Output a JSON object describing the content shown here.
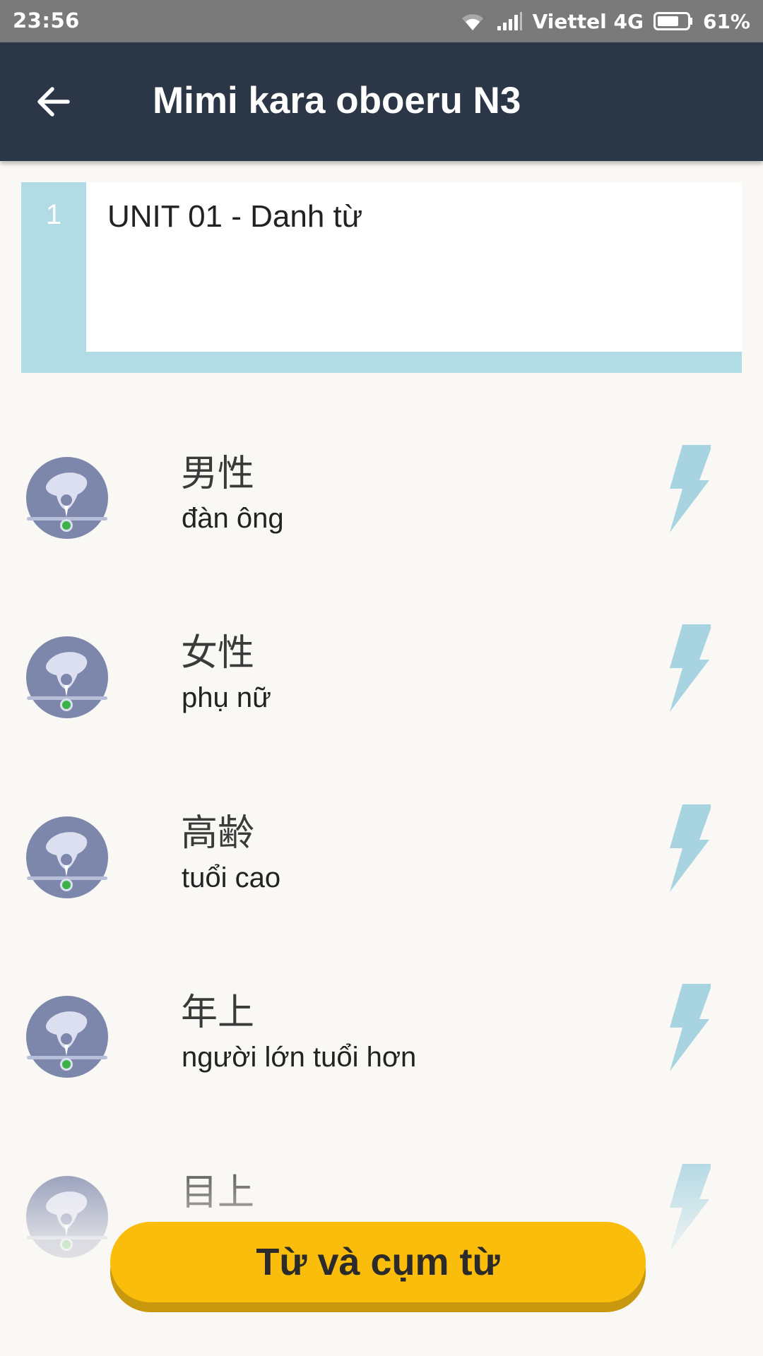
{
  "status_bar": {
    "time": "23:56",
    "carrier": "Viettel 4G",
    "battery": "61%"
  },
  "app_bar": {
    "title": "Mimi kara oboeru N3",
    "back_icon": "arrow-left-icon"
  },
  "unit": {
    "number": "1",
    "title": "UNIT 01 - Danh từ"
  },
  "vocab": [
    {
      "kanji": "男性",
      "meaning": "đàn ông"
    },
    {
      "kanji": "女性",
      "meaning": "phụ nữ"
    },
    {
      "kanji": "高齢",
      "meaning": "tuổi cao"
    },
    {
      "kanji": "年上",
      "meaning": "người lớn tuổi hơn"
    },
    {
      "kanji": "目上",
      "meaning": ""
    }
  ],
  "bottom_button": {
    "label": "Từ và cụm từ"
  },
  "colors": {
    "status_bar": "#7a7a7a",
    "app_bar": "#2b3647",
    "unit_accent": "#b2dce5",
    "flash_icon": "#a8d4e2",
    "button": "#fbbd0b",
    "background": "#faf8f4"
  }
}
